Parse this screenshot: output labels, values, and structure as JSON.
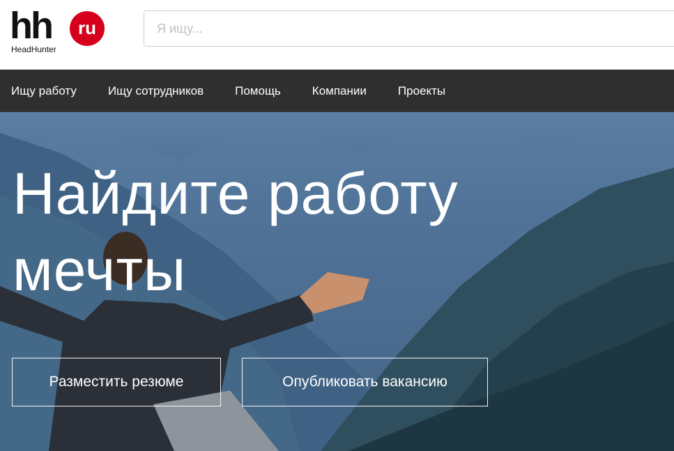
{
  "logo": {
    "main": "hh",
    "badge": "ru",
    "subtitle": "HeadHunter",
    "badge_color": "#d6001c"
  },
  "search": {
    "placeholder": "Я ищу...",
    "value": ""
  },
  "nav": {
    "items": [
      {
        "label": "Ищу работу"
      },
      {
        "label": "Ищу сотрудников"
      },
      {
        "label": "Помощь"
      },
      {
        "label": "Компании"
      },
      {
        "label": "Проекты"
      }
    ]
  },
  "hero": {
    "headline_line1": "Найдите работу",
    "headline_line2": "мечты",
    "primary_button": "Разместить резюме",
    "secondary_button": "Опубликовать вакансию"
  }
}
